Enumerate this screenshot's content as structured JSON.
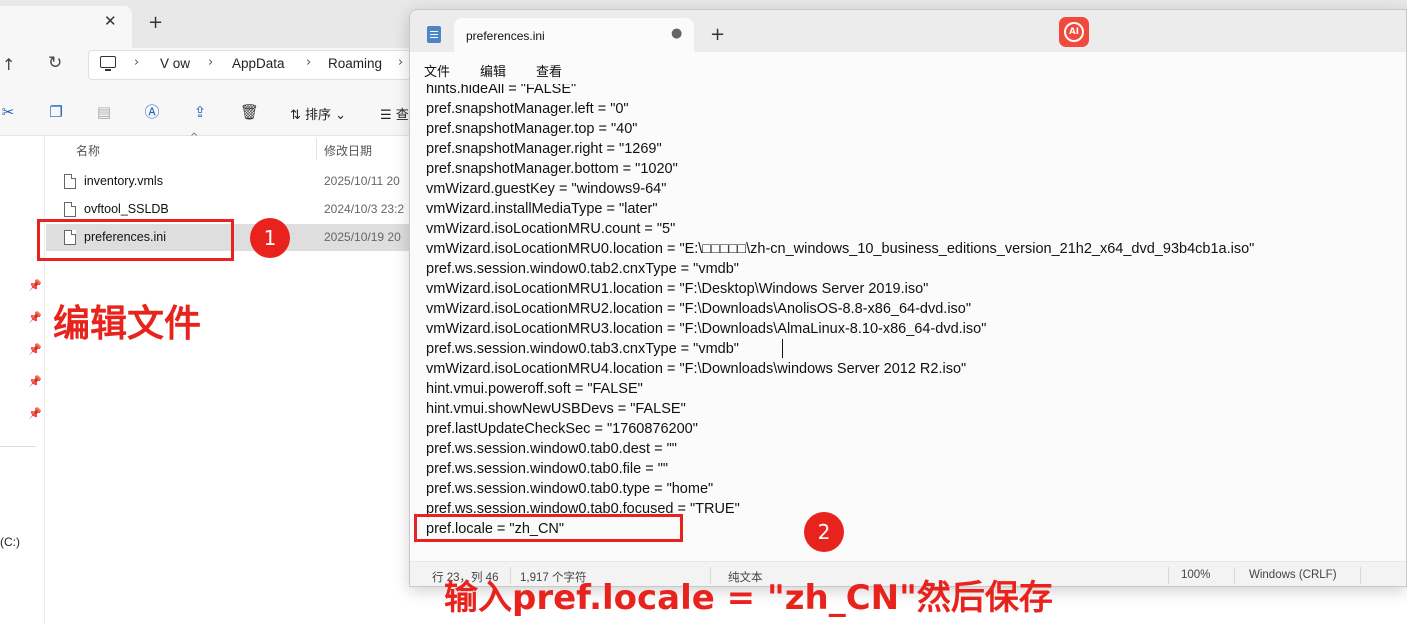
{
  "explorer": {
    "tab_close": "✕",
    "new_tab": "+",
    "breadcrumbs": [
      "V ow",
      "AppData",
      "Roaming"
    ],
    "toolbar": {
      "sort_label": "排序",
      "view_label": "查"
    },
    "columns": {
      "name": "名称",
      "modified": "修改日期"
    },
    "files": [
      {
        "name": "inventory.vmls",
        "date": "2025/10/11 20"
      },
      {
        "name": "ovftool_SSLDB",
        "date": "2024/10/3 23:2"
      },
      {
        "name": "preferences.ini",
        "date": "2025/10/19 20"
      }
    ],
    "drive_label": "(C:)"
  },
  "notepad": {
    "tab_title": "preferences.ini",
    "ai_badge": "AI",
    "menu": [
      "文件",
      "编辑",
      "查看"
    ],
    "lines": [
      "hints.hideAll = \"FALSE\"",
      "pref.snapshotManager.left = \"0\"",
      "pref.snapshotManager.top = \"40\"",
      "pref.snapshotManager.right = \"1269\"",
      "pref.snapshotManager.bottom = \"1020\"",
      "vmWizard.guestKey = \"windows9-64\"",
      "vmWizard.installMediaType = \"later\"",
      "vmWizard.isoLocationMRU.count = \"5\"",
      "vmWizard.isoLocationMRU0.location = \"E:\\□□□□□\\zh-cn_windows_10_business_editions_version_21h2_x64_dvd_93b4cb1a.iso\"",
      "pref.ws.session.window0.tab2.cnxType = \"vmdb\"",
      "vmWizard.isoLocationMRU1.location = \"F:\\Desktop\\Windows Server 2019.iso\"",
      "vmWizard.isoLocationMRU2.location = \"F:\\Downloads\\AnolisOS-8.8-x86_64-dvd.iso\"",
      "vmWizard.isoLocationMRU3.location = \"F:\\Downloads\\AlmaLinux-8.10-x86_64-dvd.iso\"",
      "pref.ws.session.window0.tab3.cnxType = \"vmdb\"",
      "vmWizard.isoLocationMRU4.location = \"F:\\Downloads\\windows Server 2012 R2.iso\"",
      "hint.vmui.poweroff.soft = \"FALSE\"",
      "hint.vmui.showNewUSBDevs = \"FALSE\"",
      "pref.lastUpdateCheckSec = \"1760876200\"",
      "pref.ws.session.window0.tab0.dest = \"\"",
      "pref.ws.session.window0.tab0.file = \"\"",
      "pref.ws.session.window0.tab0.type = \"home\"",
      "pref.ws.session.window0.tab0.focused = \"TRUE\"",
      "pref.locale = \"zh_CN\""
    ],
    "status": {
      "position": "行 23，列 46",
      "chars": "1,917 个字符",
      "format": "纯文本",
      "zoom": "100%",
      "encoding": "Windows (CRLF)"
    }
  },
  "annotations": {
    "badge1": "1",
    "badge2": "2",
    "label_edit": "编辑文件",
    "label_instruction": "输入pref.locale = \"zh_CN\"然后保存",
    "accent_color": "#e8231d"
  }
}
